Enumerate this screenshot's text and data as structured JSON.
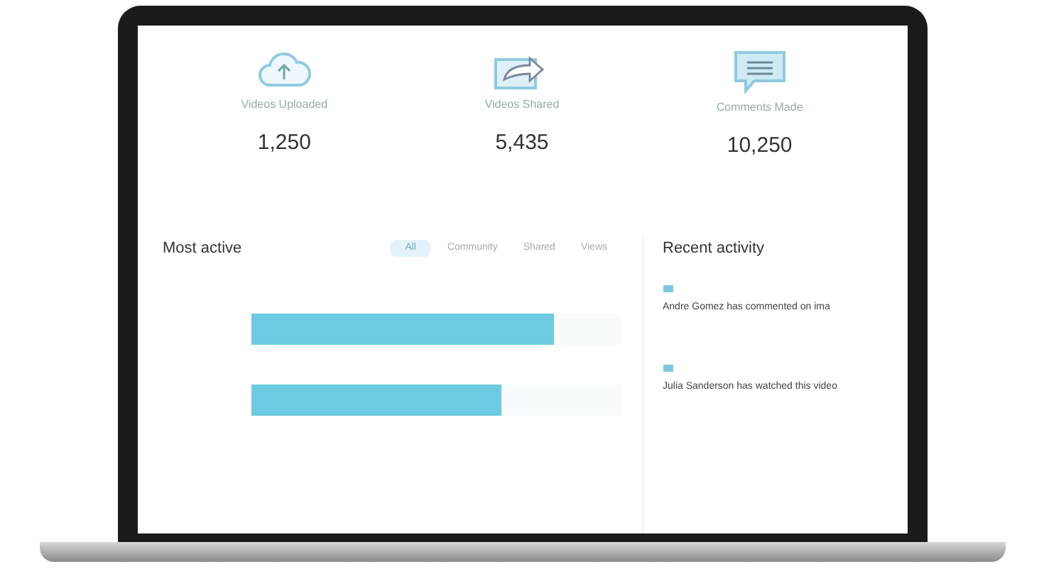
{
  "stats": [
    {
      "kind": "upload",
      "label": "Videos Uploaded",
      "value": "1,250"
    },
    {
      "kind": "share",
      "label": "Videos Shared",
      "value": "5,435"
    },
    {
      "kind": "comment",
      "label": "Comments Made",
      "value": "10,250"
    }
  ],
  "most_active": {
    "title": "Most active",
    "tabs": [
      {
        "label": "All",
        "selected": true
      },
      {
        "label": "Community",
        "selected": false
      },
      {
        "label": "Shared",
        "selected": false
      },
      {
        "label": "Views",
        "selected": false
      }
    ],
    "bars": [
      {
        "level": 0.82
      },
      {
        "level": 0.68
      }
    ]
  },
  "recent_activity": {
    "title": "Recent activity",
    "items": [
      {
        "text": "Andre Gomez has commented on ima"
      },
      {
        "text": "Julia Sanderson has watched this video"
      }
    ]
  }
}
